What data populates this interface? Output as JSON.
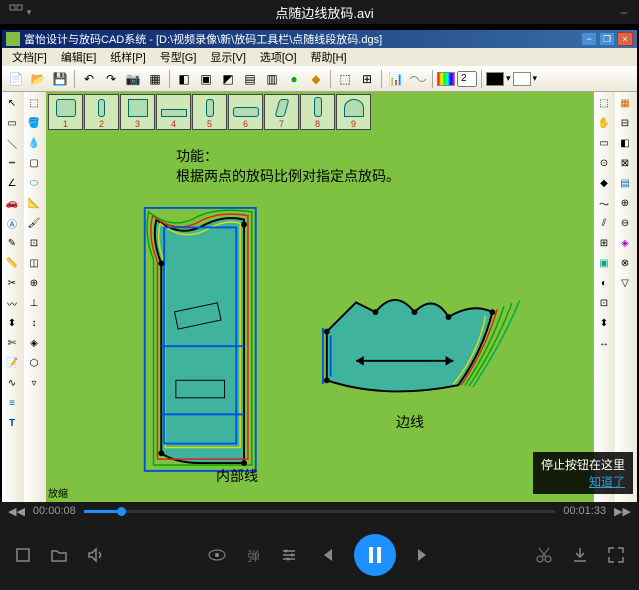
{
  "player": {
    "title": "点随边线放码.avi",
    "current_time": "00:00:08",
    "total_time": "00:01:33",
    "danmu_label": "弹",
    "tooltip": {
      "text": "停止按钮在这里",
      "link": "知道了"
    }
  },
  "cad": {
    "title": "富怡设计与放码CAD系统 - [D:\\视频录像\\新\\放码工具栏\\点随线段放码.dgs]",
    "menus": [
      "文档[F]",
      "编辑[E]",
      "纸样[P]",
      "号型[G]",
      "显示[V]",
      "选项[O]",
      "帮助[H]"
    ],
    "toolbar_input": "2",
    "size_numbers": [
      "1",
      "2",
      "3",
      "4",
      "5",
      "6",
      "7",
      "8",
      "9"
    ],
    "caption": {
      "title": "功能：",
      "body": "根据两点的放码比例对指定点放码。"
    },
    "label_inner": "内部线",
    "label_edge": "边线",
    "ruler_label": "放缩"
  },
  "colors": {
    "accent": "#1e90ff",
    "canvas": "#7fc241",
    "teal": "#2a9d8f"
  }
}
